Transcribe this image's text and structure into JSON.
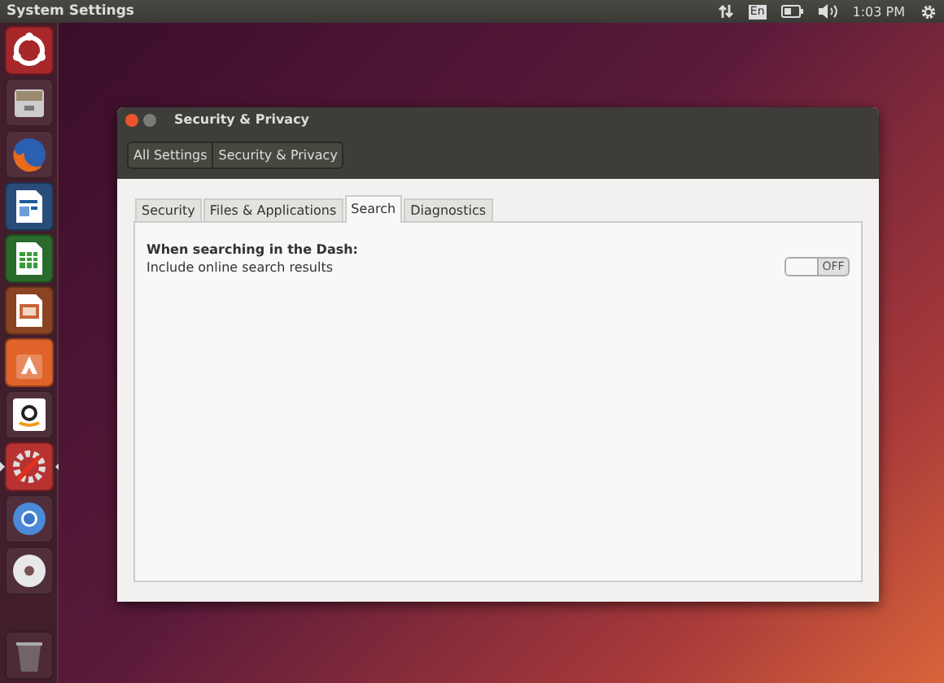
{
  "top_bar": {
    "title": "System Settings",
    "keyboard": "En",
    "time": "1:03 PM"
  },
  "launcher": [
    {
      "kind": "ubuntu",
      "selected": false
    },
    {
      "kind": "files",
      "selected": false
    },
    {
      "kind": "firefox",
      "selected": false
    },
    {
      "kind": "writer",
      "selected": false
    },
    {
      "kind": "calc",
      "selected": false
    },
    {
      "kind": "impress",
      "selected": false
    },
    {
      "kind": "software",
      "selected": false
    },
    {
      "kind": "amazon",
      "selected": false
    },
    {
      "kind": "settings",
      "selected": true
    },
    {
      "kind": "chromium",
      "selected": false
    },
    {
      "kind": "disc",
      "selected": false
    },
    {
      "kind": "trash",
      "selected": false
    }
  ],
  "window": {
    "title": "Security & Privacy",
    "breadcrumbs": [
      "All Settings",
      "Security & Privacy"
    ],
    "tabs": [
      {
        "label": "Security",
        "selected": false
      },
      {
        "label": "Files & Applications",
        "selected": false
      },
      {
        "label": "Search",
        "selected": true
      },
      {
        "label": "Diagnostics",
        "selected": false
      }
    ],
    "section_title": "When searching in the Dash:",
    "setting": {
      "label": "Include online search results",
      "on": false,
      "state_text": "OFF"
    }
  }
}
